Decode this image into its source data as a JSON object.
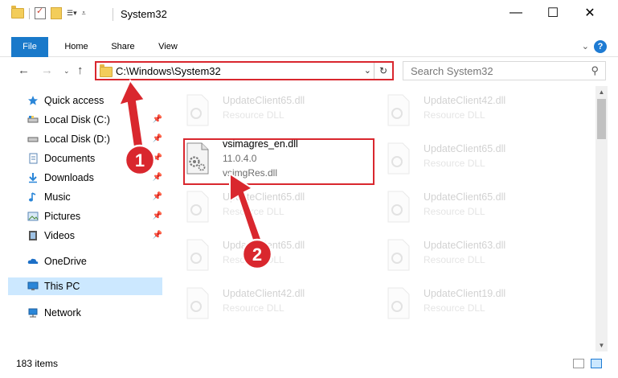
{
  "window": {
    "title": "System32",
    "minimize_glyph": "—",
    "maximize_glyph": "☐",
    "close_glyph": "✕"
  },
  "ribbon": {
    "tabs": [
      "File",
      "Home",
      "Share",
      "View"
    ],
    "help_glyph": "?"
  },
  "address_bar": {
    "path": "C:\\Windows\\System32",
    "dropdown_glyph": "⌄",
    "refresh_glyph": "↻"
  },
  "search": {
    "placeholder": "Search System32",
    "icon": "search-icon"
  },
  "nav_pane": {
    "items": [
      {
        "label": "Quick access",
        "icon": "star-icon",
        "pinned": false
      },
      {
        "label": "Local Disk (C:)",
        "icon": "drive-icon",
        "pinned": true
      },
      {
        "label": "Local Disk (D:)",
        "icon": "drive-icon",
        "pinned": true
      },
      {
        "label": "Documents",
        "icon": "documents-icon",
        "pinned": true
      },
      {
        "label": "Downloads",
        "icon": "download-icon",
        "pinned": true
      },
      {
        "label": "Music",
        "icon": "music-icon",
        "pinned": true
      },
      {
        "label": "Pictures",
        "icon": "pictures-icon",
        "pinned": true
      },
      {
        "label": "Videos",
        "icon": "videos-icon",
        "pinned": true
      },
      {
        "label": "OneDrive",
        "icon": "cloud-icon",
        "pinned": false
      },
      {
        "label": "This PC",
        "icon": "computer-icon",
        "pinned": false,
        "selected": true
      },
      {
        "label": "Network",
        "icon": "network-icon",
        "pinned": false
      }
    ]
  },
  "files": [
    {
      "name": "UpdateClient65.dll",
      "desc": "Resource DLL",
      "faded": true
    },
    {
      "name": "UpdateClient42.dll",
      "desc": "Resource DLL",
      "faded": true
    },
    {
      "name": "vsimagres_en.dll",
      "version": "11.0.4.0",
      "desc": "vsimgRes.dll",
      "faded": false
    },
    {
      "name": "UpdateClient65.dll",
      "desc": "Resource DLL",
      "faded": true
    },
    {
      "name": "UpdateClient65.dll",
      "desc": "Resource DLL",
      "faded": true
    },
    {
      "name": "UpdateClient65.dll",
      "desc": "Resource DLL",
      "faded": true
    },
    {
      "name": "UpdateClient65.dll",
      "desc": "Resource DLL",
      "faded": true
    },
    {
      "name": "UpdateClient63.dll",
      "desc": "Resource DLL",
      "faded": true
    },
    {
      "name": "UpdateClient42.dll",
      "desc": "Resource DLL",
      "faded": true
    },
    {
      "name": "UpdateClient19.dll",
      "desc": "Resource DLL",
      "faded": true
    }
  ],
  "status": {
    "item_count": "183 items"
  },
  "annotations": {
    "step1": "1",
    "step2": "2",
    "color": "#d9272e"
  }
}
